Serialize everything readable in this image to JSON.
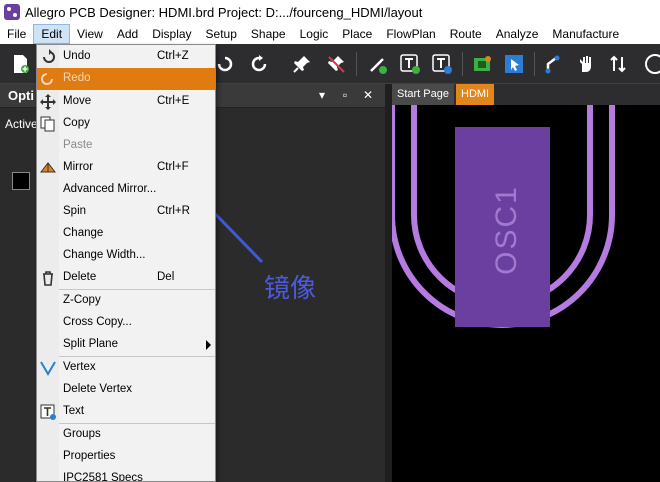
{
  "window": {
    "title": "Allegro PCB Designer: HDMI.brd  Project: D:.../fourceng_HDMI/layout"
  },
  "menubar": {
    "items": [
      {
        "label": "File",
        "u": "F"
      },
      {
        "label": "Edit",
        "u": "E",
        "active": true
      },
      {
        "label": "View",
        "u": "V"
      },
      {
        "label": "Add",
        "u": "A"
      },
      {
        "label": "Display",
        "u": "D"
      },
      {
        "label": "Setup",
        "u": "S"
      },
      {
        "label": "Shape",
        "u": "S"
      },
      {
        "label": "Logic",
        "u": "L"
      },
      {
        "label": "Place",
        "u": "P"
      },
      {
        "label": "FlowPlan",
        "u": "n"
      },
      {
        "label": "Route",
        "u": "R"
      },
      {
        "label": "Analyze",
        "u": "A"
      },
      {
        "label": "Manufacture",
        "u": "M"
      }
    ]
  },
  "panel": {
    "title": "Opti",
    "active_label": "Active",
    "buttons": [
      "▾",
      "▫",
      "✕"
    ]
  },
  "tabs": {
    "start": "Start Page",
    "hdmi": "HDMI"
  },
  "edit_menu": {
    "items": [
      {
        "label": "Undo",
        "shortcut": "Ctrl+Z",
        "icon": "undo-icon"
      },
      {
        "label": "Redo",
        "shortcut": "",
        "icon": "redo-icon",
        "disabled": true,
        "highlight": true
      },
      {
        "label": "Move",
        "shortcut": "Ctrl+E",
        "icon": "move-icon"
      },
      {
        "label": "Copy",
        "shortcut": "",
        "icon": "copy-icon"
      },
      {
        "label": "Paste",
        "shortcut": "",
        "icon": "",
        "disabled": true
      },
      {
        "label": "Mirror",
        "shortcut": "Ctrl+F",
        "icon": "mirror-icon"
      },
      {
        "label": "Advanced Mirror...",
        "shortcut": "",
        "icon": ""
      },
      {
        "label": "Spin",
        "shortcut": "Ctrl+R",
        "icon": ""
      },
      {
        "label": "Change",
        "shortcut": "",
        "icon": ""
      },
      {
        "label": "Change Width...",
        "shortcut": "",
        "icon": ""
      },
      {
        "label": "Delete",
        "shortcut": "Del",
        "icon": "delete-icon"
      },
      {
        "label": "Z-Copy",
        "shortcut": "",
        "icon": ""
      },
      {
        "label": "Cross Copy...",
        "shortcut": "",
        "icon": ""
      },
      {
        "label": "Split Plane",
        "shortcut": "",
        "icon": "",
        "submenu": true
      },
      {
        "label": "Vertex",
        "shortcut": "",
        "icon": "vertex-icon"
      },
      {
        "label": "Delete Vertex",
        "shortcut": "",
        "icon": ""
      },
      {
        "label": "Text",
        "shortcut": "",
        "icon": "text-icon"
      },
      {
        "label": "Groups",
        "shortcut": "",
        "icon": ""
      },
      {
        "label": "Properties",
        "shortcut": "",
        "icon": ""
      },
      {
        "label": "IPC2581 Specs",
        "shortcut": "",
        "icon": ""
      }
    ]
  },
  "canvas": {
    "component_label": "OSC1",
    "component_color": "#6b3fa0",
    "trace_color": "#b57be0"
  },
  "annotation": {
    "text": "镜像",
    "color": "#4b5ae0"
  },
  "colors": {
    "highlight": "#e07b12",
    "tab_active": "#e0861c"
  }
}
